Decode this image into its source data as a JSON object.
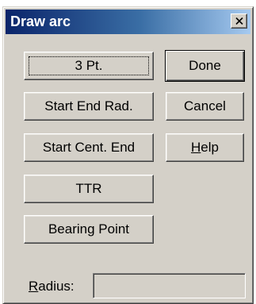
{
  "window": {
    "title": "Draw arc",
    "close_icon": "close-icon"
  },
  "arc_methods": [
    {
      "label": "3 Pt."
    },
    {
      "label": "Start End Rad."
    },
    {
      "label": "Start Cent. End"
    },
    {
      "label": "TTR"
    },
    {
      "label": "Bearing Point"
    }
  ],
  "actions": {
    "done_label": "Done",
    "cancel_label": "Cancel",
    "help_label": "Help",
    "help_mnemonic": "H",
    "help_rest": "elp"
  },
  "radius": {
    "label": "Radius:",
    "mnemonic": "R",
    "label_rest": "adius:",
    "value": ""
  },
  "colors": {
    "dialog_face": "#d4d0c8",
    "title_gradient_start": "#0a246a",
    "title_gradient_end": "#a6caf0",
    "title_text": "#ffffff"
  }
}
